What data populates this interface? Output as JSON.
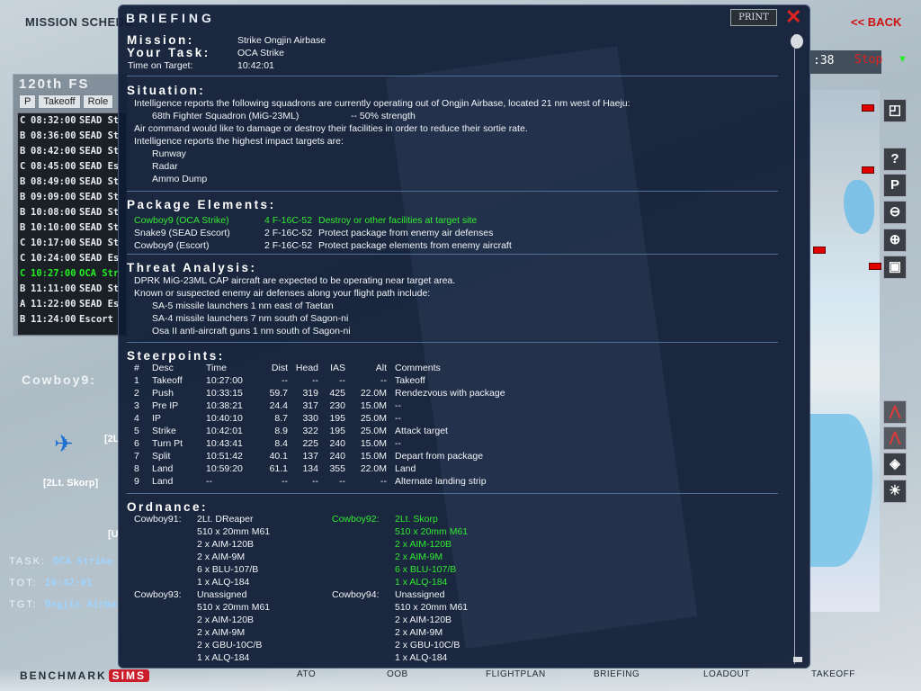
{
  "app": {
    "screen_title": "MISSION SCHEDU",
    "back_label": "<< BACK",
    "squadron": "120th FS",
    "list_tabs": [
      "P",
      "Takeoff",
      "Role"
    ],
    "flights": [
      {
        "p": "C",
        "t": "08:32:00",
        "role": "SEAD St"
      },
      {
        "p": "B",
        "t": "08:36:00",
        "role": "SEAD St"
      },
      {
        "p": "B",
        "t": "08:42:00",
        "role": "SEAD St"
      },
      {
        "p": "C",
        "t": "08:45:00",
        "role": "SEAD Es"
      },
      {
        "p": "B",
        "t": "08:49:00",
        "role": "SEAD St"
      },
      {
        "p": "B",
        "t": "09:09:00",
        "role": "SEAD St"
      },
      {
        "p": "B",
        "t": "10:08:00",
        "role": "SEAD St"
      },
      {
        "p": "B",
        "t": "10:10:00",
        "role": "SEAD St"
      },
      {
        "p": "C",
        "t": "10:17:00",
        "role": "SEAD St"
      },
      {
        "p": "C",
        "t": "10:24:00",
        "role": "SEAD Es"
      },
      {
        "p": "C",
        "t": "10:27:00",
        "role": "OCA Str",
        "highlight": true
      },
      {
        "p": "B",
        "t": "11:11:00",
        "role": "SEAD St"
      },
      {
        "p": "A",
        "t": "11:22:00",
        "role": "SEAD Es"
      },
      {
        "p": "B",
        "t": "11:24:00",
        "role": "Escort"
      }
    ],
    "flight_name": "Cowboy9:",
    "pilot_tag": "[2Lt. Skorp]",
    "side_label_2l": "[2L",
    "side_label_u": "[U",
    "task_label": "TASK:",
    "task_value": "OCA Strike",
    "tot_label": "TOT:",
    "tot_value": "10:42:01",
    "tgt_label": "TGT:",
    "tgt_value": "Ongjin Airbase",
    "clock": ":38",
    "clock_state": "Stop",
    "brand_text": "BENCHMARK",
    "brand_badge": "SIMS",
    "nav": [
      "ATO",
      "OOB",
      "FLIGHTPLAN",
      "BRIEFING",
      "LOADOUT",
      "TAKEOFF"
    ]
  },
  "briefing": {
    "title": "BRIEFING",
    "print_label": "PRINT",
    "mission_label": "Mission:",
    "mission_value": "Strike Ongjin Airbase",
    "task_label": "Your Task:",
    "task_value": "OCA Strike",
    "tot_label": "Time on Target:",
    "tot_value": "10:42:01",
    "situation": {
      "header": "Situation:",
      "line1": "Intelligence reports the following squadrons are currently operating out of Ongjin Airbase, located 21 nm west of Haeju:",
      "squadron": "68th Fighter Squadron (MiG-23ML)",
      "strength": "--  50% strength",
      "line2": "Air command would like to damage or destroy their facilities in order to reduce their sortie rate.",
      "line3": "Intelligence reports the highest impact targets are:",
      "targets": [
        "Runway",
        "Radar",
        "Ammo Dump"
      ]
    },
    "package": {
      "header": "Package Elements:",
      "rows": [
        {
          "name": "Cowboy9 (OCA Strike)",
          "ac": "4 F-16C-52",
          "task": "Destroy  or other facilities at target site",
          "highlight": true
        },
        {
          "name": "Snake9 (SEAD Escort)",
          "ac": "2 F-16C-52",
          "task": "Protect package from enemy air defenses"
        },
        {
          "name": "Cowboy9 (Escort)",
          "ac": "2 F-16C-52",
          "task": "Protect package elements from enemy aircraft"
        }
      ]
    },
    "threat": {
      "header": "Threat Analysis:",
      "line1": "DPRK MiG-23ML CAP aircraft are expected to be operating near target area.",
      "line2": "Known or suspected enemy air defenses along your flight path include:",
      "items": [
        "SA-5 missile launchers 1 nm east of Taetan",
        "SA-4 missile launchers 7 nm south of Sagon-ni",
        "Osa II anti-aircraft guns 1 nm south of Sagon-ni"
      ]
    },
    "steerpoints": {
      "header": "Steerpoints:",
      "columns": [
        "#",
        "Desc",
        "Time",
        "Dist",
        "Head",
        "IAS",
        "Alt",
        "Comments"
      ],
      "rows": [
        [
          "1",
          "Takeoff",
          "10:27:00",
          "--",
          "--",
          "--",
          "--",
          "Takeoff"
        ],
        [
          "2",
          "Push",
          "10:33:15",
          "59.7",
          "319",
          "425",
          "22.0M",
          "Rendezvous with package"
        ],
        [
          "3",
          "Pre IP",
          "10:38:21",
          "24.4",
          "317",
          "230",
          "15.0M",
          "--"
        ],
        [
          "4",
          "IP",
          "10:40:10",
          "8.7",
          "330",
          "195",
          "25.0M",
          "--"
        ],
        [
          "5",
          "Strike",
          "10:42:01",
          "8.9",
          "322",
          "195",
          "25.0M",
          "Attack target"
        ],
        [
          "6",
          "Turn Pt",
          "10:43:41",
          "8.4",
          "225",
          "240",
          "15.0M",
          "--"
        ],
        [
          "7",
          "Split",
          "10:51:42",
          "40.1",
          "137",
          "240",
          "15.0M",
          "Depart from package"
        ],
        [
          "8",
          "Land",
          "10:59:20",
          "61.1",
          "134",
          "355",
          "22.0M",
          "Land"
        ],
        [
          "9",
          "Land",
          "--",
          "--",
          "--",
          "--",
          "--",
          "Alternate landing strip"
        ]
      ]
    },
    "ordnance": {
      "header": "Ordnance:",
      "blocks": [
        {
          "callsign": "Cowboy91:",
          "pilot": "2Lt. DReaper",
          "items": [
            "510 x 20mm M61",
            "2 x AIM-120B",
            "2 x AIM-9M",
            "6 x BLU-107/B",
            "1 x ALQ-184"
          ]
        },
        {
          "callsign": "Cowboy92:",
          "pilot": "2Lt. Skorp",
          "items": [
            "510 x 20mm M61",
            "2 x AIM-120B",
            "2 x AIM-9M",
            "6 x BLU-107/B",
            "1 x ALQ-184"
          ],
          "highlight": true
        },
        {
          "callsign": "Cowboy93:",
          "pilot": "Unassigned",
          "items": [
            "510 x 20mm M61",
            "2 x AIM-120B",
            "2 x AIM-9M",
            "2 x GBU-10C/B",
            "1 x ALQ-184"
          ]
        },
        {
          "callsign": "Cowboy94:",
          "pilot": "Unassigned",
          "items": [
            "510 x 20mm M61",
            "2 x AIM-120B",
            "2 x AIM-9M",
            "2 x GBU-10C/B",
            "1 x ALQ-184"
          ]
        }
      ]
    }
  }
}
